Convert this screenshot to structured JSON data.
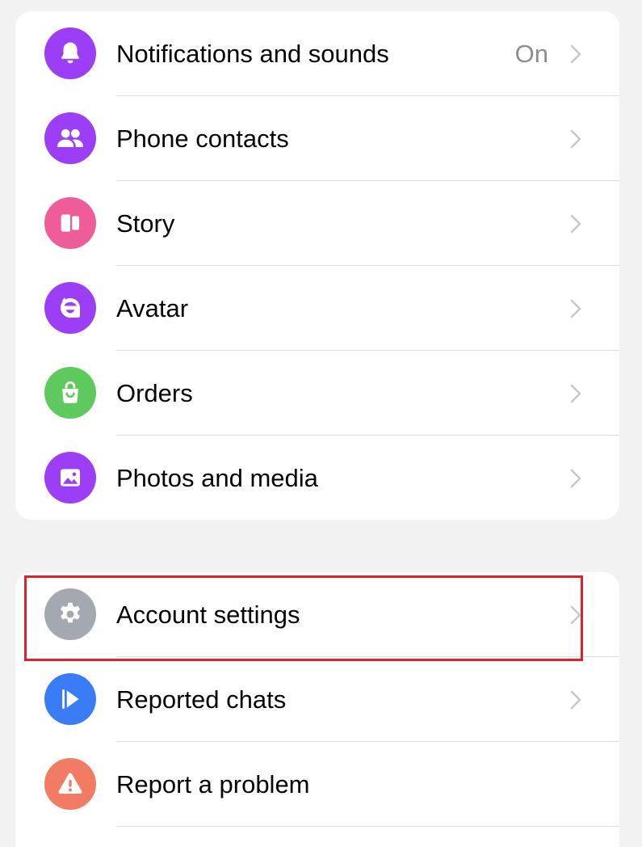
{
  "group1": {
    "items": [
      {
        "label": "Notifications and sounds",
        "value": "On",
        "icon": "bell-icon",
        "color": "#9b3ef5"
      },
      {
        "label": "Phone contacts",
        "value": "",
        "icon": "people-icon",
        "color": "#9b3ef5"
      },
      {
        "label": "Story",
        "value": "",
        "icon": "story-icon",
        "color": "#ef5d98"
      },
      {
        "label": "Avatar",
        "value": "",
        "icon": "avatar-icon",
        "color": "#9b3ef5"
      },
      {
        "label": "Orders",
        "value": "",
        "icon": "shopping-bag-icon",
        "color": "#5ec95c"
      },
      {
        "label": "Photos and media",
        "value": "",
        "icon": "photo-icon",
        "color": "#9b3ef5"
      }
    ]
  },
  "group2": {
    "items": [
      {
        "label": "Account settings",
        "value": "",
        "icon": "gear-icon",
        "color": "#a4a9b1"
      },
      {
        "label": "Reported chats",
        "value": "",
        "icon": "flag-icon",
        "color": "#3a7cf5"
      },
      {
        "label": "Report a problem",
        "value": "",
        "icon": "warning-icon",
        "color": "#f17c63"
      }
    ]
  },
  "colors": {
    "background": "#f2f2f2",
    "highlight": "#e0202b",
    "chevron": "#c7c7cc"
  }
}
